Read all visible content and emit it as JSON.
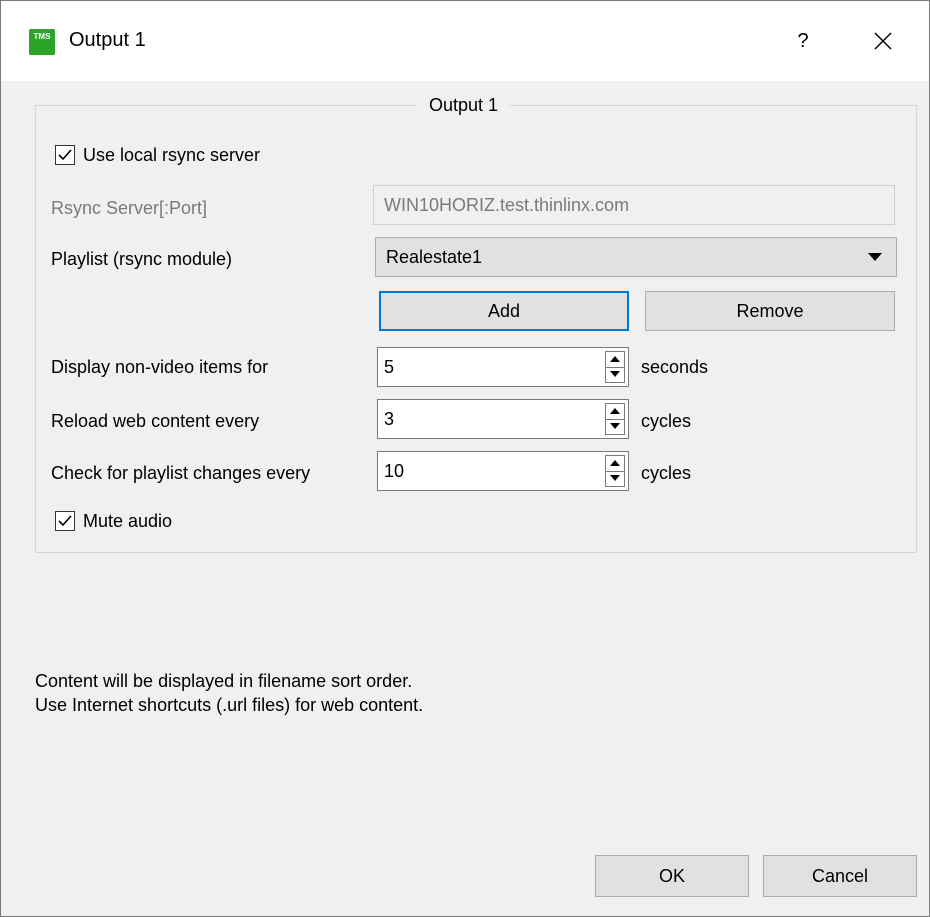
{
  "window": {
    "title": "Output 1",
    "app_icon_text": "TMS",
    "help_label": "?"
  },
  "group": {
    "title": "Output 1"
  },
  "form": {
    "use_local_rsync": {
      "label": "Use local rsync server",
      "checked": true
    },
    "rsync_server": {
      "label": "Rsync Server[:Port]",
      "value": "WIN10HORIZ.test.thinlinx.com"
    },
    "playlist": {
      "label": "Playlist (rsync module)",
      "selected": "Realestate1"
    },
    "add_label": "Add",
    "remove_label": "Remove",
    "display_non_video": {
      "label": "Display non-video items for",
      "value": "5",
      "unit": "seconds"
    },
    "reload_web": {
      "label": "Reload web content every",
      "value": "3",
      "unit": "cycles"
    },
    "check_playlist": {
      "label": "Check for playlist changes every",
      "value": "10",
      "unit": "cycles"
    },
    "mute_audio": {
      "label": "Mute audio",
      "checked": true
    }
  },
  "info": {
    "line1": "Content will be displayed in filename sort order.",
    "line2": "Use Internet shortcuts (.url files) for web content."
  },
  "footer": {
    "ok_label": "OK",
    "cancel_label": "Cancel"
  },
  "colors": {
    "accent": "#0078d7",
    "icon_green": "#2aa52a"
  }
}
